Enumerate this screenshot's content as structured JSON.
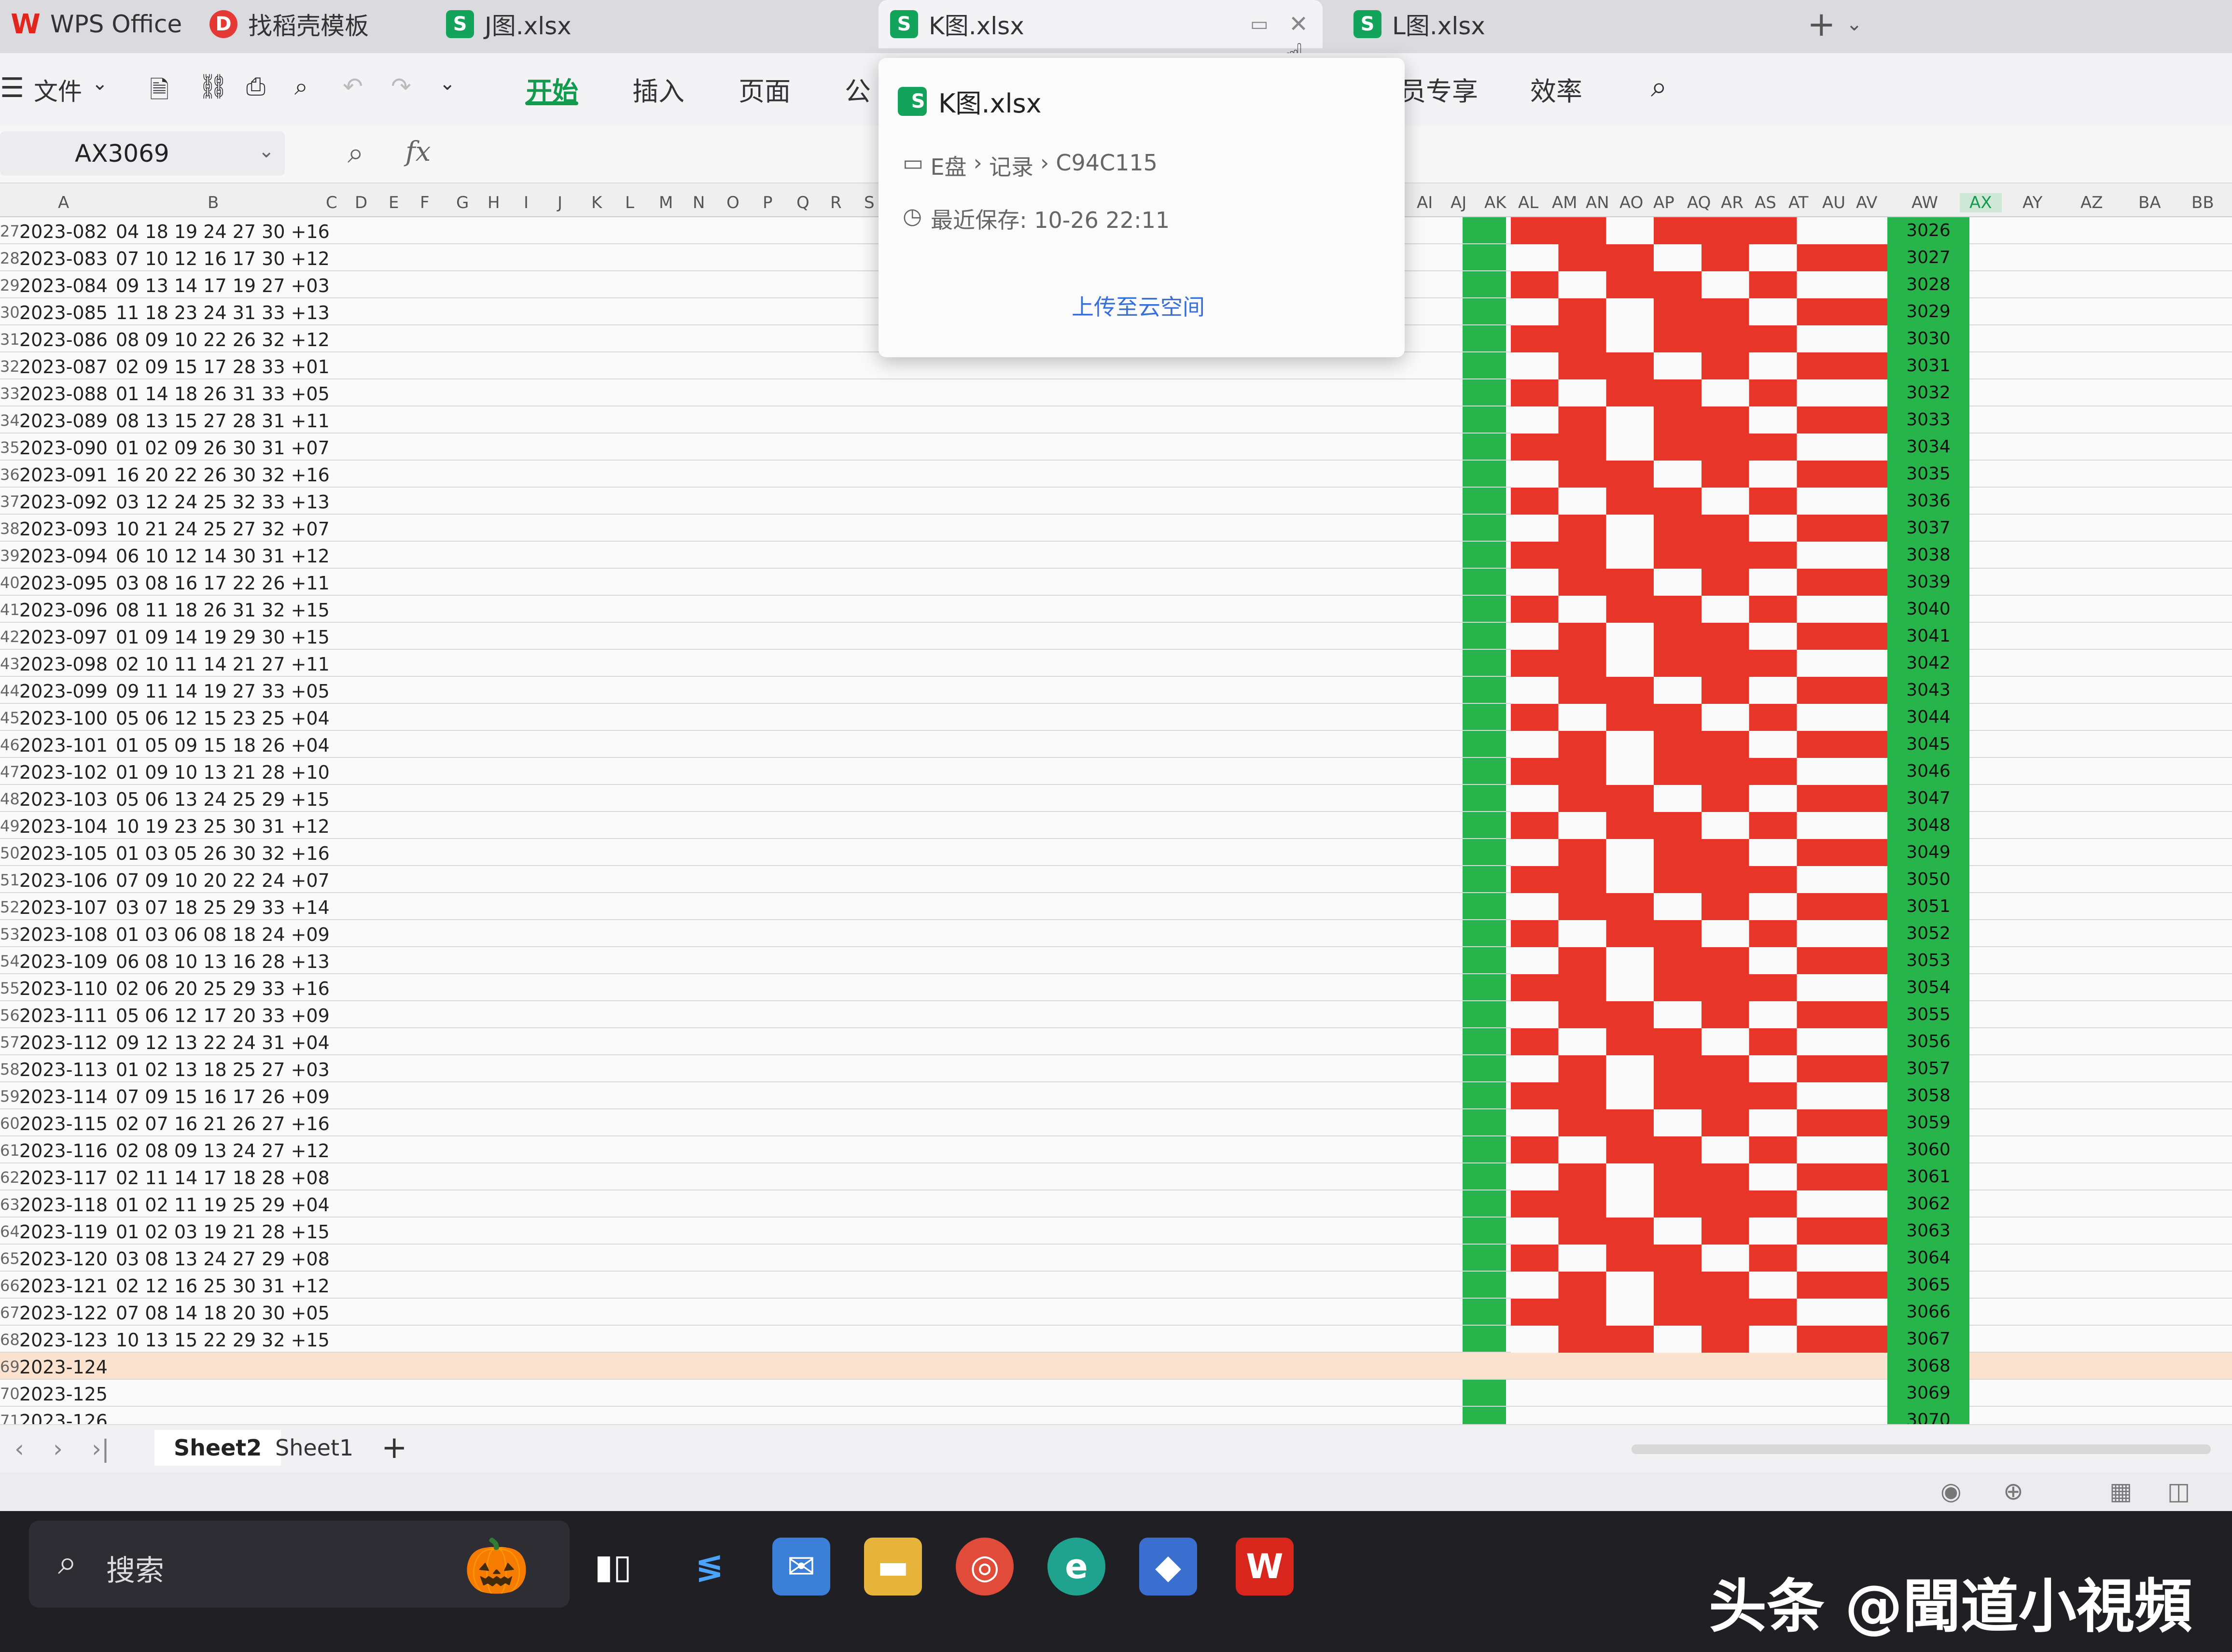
{
  "window": {
    "app_name": "WPS Office"
  },
  "tabs": [
    {
      "label": "WPS Office"
    },
    {
      "label": "找稻壳模板"
    },
    {
      "label": "J图.xlsx"
    },
    {
      "label": "K图.xlsx",
      "active": true
    },
    {
      "label": "L图.xlsx"
    }
  ],
  "toolbar": {
    "file_label": "文件",
    "ribbon_tabs": [
      "开始",
      "插入",
      "页面",
      "公",
      "员专享",
      "效率"
    ],
    "active_tab": "开始"
  },
  "formula_bar": {
    "name_box": "AX3069",
    "fx_label": "fx"
  },
  "popup": {
    "file_name": "K图.xlsx",
    "path_drive": "E盘",
    "path_sep1": "›",
    "path_dir": "记录",
    "path_sep2": "›",
    "path_sub": "C94C115",
    "last_saved": "最近保存: 10-26 22:11",
    "upload_link": "上传至云空间"
  },
  "column_headers": [
    "A",
    "B",
    "C",
    "D",
    "E",
    "F",
    "G",
    "H",
    "I",
    "J",
    "K",
    "L",
    "M",
    "N",
    "O",
    "P",
    "Q",
    "R",
    "S",
    "AI",
    "AJ",
    "AK",
    "AL",
    "AM",
    "AN",
    "AO",
    "AP",
    "AQ",
    "AR",
    "AS",
    "AT",
    "AU",
    "AV",
    "AW",
    "AX",
    "AY",
    "AZ",
    "BA",
    "BB"
  ],
  "rows": [
    {
      "n": "27",
      "date": "2023-082",
      "nums": "04 18 19 24 27 30 +16",
      "aw": "3026"
    },
    {
      "n": "28",
      "date": "2023-083",
      "nums": "07 10 12 16 17 30 +12",
      "aw": "3027"
    },
    {
      "n": "29",
      "date": "2023-084",
      "nums": "09 13 14 17 19 27 +03",
      "aw": "3028"
    },
    {
      "n": "30",
      "date": "2023-085",
      "nums": "11 18 23 24 31 33 +13",
      "aw": "3029"
    },
    {
      "n": "31",
      "date": "2023-086",
      "nums": "08 09 10 22 26 32 +12",
      "aw": "3030"
    },
    {
      "n": "32",
      "date": "2023-087",
      "nums": "02 09 15 17 28 33 +01",
      "aw": "3031"
    },
    {
      "n": "33",
      "date": "2023-088",
      "nums": "01 14 18 26 31 33 +05",
      "aw": "3032"
    },
    {
      "n": "34",
      "date": "2023-089",
      "nums": "08 13 15 27 28 31 +11",
      "aw": "3033"
    },
    {
      "n": "35",
      "date": "2023-090",
      "nums": "01 02 09 26 30 31 +07",
      "aw": "3034"
    },
    {
      "n": "36",
      "date": "2023-091",
      "nums": "16 20 22 26 30 32 +16",
      "aw": "3035"
    },
    {
      "n": "37",
      "date": "2023-092",
      "nums": "03 12 24 25 32 33 +13",
      "aw": "3036"
    },
    {
      "n": "38",
      "date": "2023-093",
      "nums": "10 21 24 25 27 32 +07",
      "aw": "3037"
    },
    {
      "n": "39",
      "date": "2023-094",
      "nums": "06 10 12 14 30 31 +12",
      "aw": "3038"
    },
    {
      "n": "40",
      "date": "2023-095",
      "nums": "03 08 16 17 22 26 +11",
      "aw": "3039"
    },
    {
      "n": "41",
      "date": "2023-096",
      "nums": "08 11 18 26 31 32 +15",
      "aw": "3040"
    },
    {
      "n": "42",
      "date": "2023-097",
      "nums": "01 09 14 19 29 30 +15",
      "aw": "3041"
    },
    {
      "n": "43",
      "date": "2023-098",
      "nums": "02 10 11 14 21 27 +11",
      "aw": "3042"
    },
    {
      "n": "44",
      "date": "2023-099",
      "nums": "09 11 14 19 27 33 +05",
      "aw": "3043"
    },
    {
      "n": "45",
      "date": "2023-100",
      "nums": "05 06 12 15 23 25 +04",
      "aw": "3044"
    },
    {
      "n": "46",
      "date": "2023-101",
      "nums": "01 05 09 15 18 26 +04",
      "aw": "3045"
    },
    {
      "n": "47",
      "date": "2023-102",
      "nums": "01 09 10 13 21 28 +10",
      "aw": "3046"
    },
    {
      "n": "48",
      "date": "2023-103",
      "nums": "05 06 13 24 25 29 +15",
      "aw": "3047"
    },
    {
      "n": "49",
      "date": "2023-104",
      "nums": "10 19 23 25 30 31 +12",
      "aw": "3048"
    },
    {
      "n": "50",
      "date": "2023-105",
      "nums": "01 03 05 26 30 32 +16",
      "aw": "3049"
    },
    {
      "n": "51",
      "date": "2023-106",
      "nums": "07 09 10 20 22 24 +07",
      "aw": "3050"
    },
    {
      "n": "52",
      "date": "2023-107",
      "nums": "03 07 18 25 29 33 +14",
      "aw": "3051"
    },
    {
      "n": "53",
      "date": "2023-108",
      "nums": "01 03 06 08 18 24 +09",
      "aw": "3052"
    },
    {
      "n": "54",
      "date": "2023-109",
      "nums": "06 08 10 13 16 28 +13",
      "aw": "3053"
    },
    {
      "n": "55",
      "date": "2023-110",
      "nums": "02 06 20 25 29 33 +16",
      "aw": "3054"
    },
    {
      "n": "56",
      "date": "2023-111",
      "nums": "05 06 12 17 20 33 +09",
      "aw": "3055"
    },
    {
      "n": "57",
      "date": "2023-112",
      "nums": "09 12 13 22 24 31 +04",
      "aw": "3056"
    },
    {
      "n": "58",
      "date": "2023-113",
      "nums": "01 02 13 18 25 27 +03",
      "aw": "3057"
    },
    {
      "n": "59",
      "date": "2023-114",
      "nums": "07 09 15 16 17 26 +09",
      "aw": "3058"
    },
    {
      "n": "60",
      "date": "2023-115",
      "nums": "02 07 16 21 26 27 +16",
      "aw": "3059"
    },
    {
      "n": "61",
      "date": "2023-116",
      "nums": "02 08 09 13 24 27 +12",
      "aw": "3060"
    },
    {
      "n": "62",
      "date": "2023-117",
      "nums": "02 11 14 17 18 28 +08",
      "aw": "3061"
    },
    {
      "n": "63",
      "date": "2023-118",
      "nums": "01 02 11 19 25 29 +04",
      "aw": "3062"
    },
    {
      "n": "64",
      "date": "2023-119",
      "nums": "01 02 03 19 21 28 +15",
      "aw": "3063"
    },
    {
      "n": "65",
      "date": "2023-120",
      "nums": "03 08 13 24 27 29 +08",
      "aw": "3064"
    },
    {
      "n": "66",
      "date": "2023-121",
      "nums": "02 12 16 25 30 31 +12",
      "aw": "3065"
    },
    {
      "n": "67",
      "date": "2023-122",
      "nums": "07 08 14 18 20 30 +05",
      "aw": "3066"
    },
    {
      "n": "68",
      "date": "2023-123",
      "nums": "10 13 15 22 29 32 +15",
      "aw": "3067"
    },
    {
      "n": "69",
      "date": "2023-124",
      "nums": "",
      "aw": "3068"
    },
    {
      "n": "70",
      "date": "2023-125",
      "nums": "",
      "aw": "3069"
    },
    {
      "n": "71",
      "date": "2023-126",
      "nums": "",
      "aw": "3070"
    }
  ],
  "sheet_tabs": [
    "Sheet2",
    "Sheet1"
  ],
  "active_sheet": "Sheet2",
  "taskbar": {
    "search_label": "搜索"
  },
  "watermark": "头条 @聞道小視頻",
  "colors": {
    "accent_green": "#129a4e",
    "cell_green": "#27b44a",
    "cell_red": "#e8352a"
  }
}
